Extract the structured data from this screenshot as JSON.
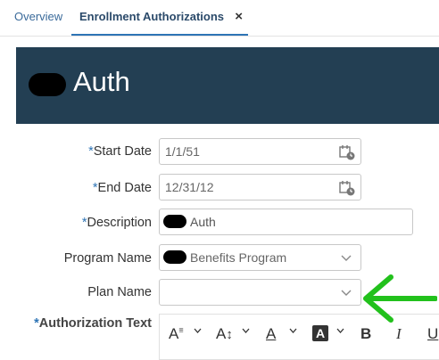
{
  "tabs": [
    {
      "label": "Overview"
    },
    {
      "label": "Enrollment Authorizations",
      "close": "×"
    }
  ],
  "header": {
    "title": "Auth"
  },
  "form": {
    "start_date": {
      "required": "*",
      "label": "Start Date",
      "value": "1/1/51"
    },
    "end_date": {
      "required": "*",
      "label": "End Date",
      "value": "12/31/12"
    },
    "description": {
      "required": "*",
      "label": "Description",
      "value": "Auth"
    },
    "program_name": {
      "label": "Program Name",
      "value": "Benefits Program"
    },
    "plan_name": {
      "label": "Plan Name",
      "value": ""
    },
    "authorization_text": {
      "required": "*",
      "label": "Authorization Text"
    }
  },
  "toolbar": {
    "items": [
      {
        "name": "font-family",
        "glyph": "A"
      },
      {
        "name": "font-size",
        "glyph": "A"
      },
      {
        "name": "text-color",
        "glyph": "A"
      },
      {
        "name": "highlight-color",
        "glyph": "A"
      },
      {
        "name": "bold",
        "glyph": "B"
      },
      {
        "name": "italic",
        "glyph": "I"
      },
      {
        "name": "underline",
        "glyph": "U"
      }
    ]
  },
  "colors": {
    "header_bg": "#233f53",
    "accent": "#2e74b5",
    "annotation_arrow": "#22c11c"
  },
  "icons": [
    "calendar-icon",
    "chevron-down-icon",
    "close-icon"
  ]
}
